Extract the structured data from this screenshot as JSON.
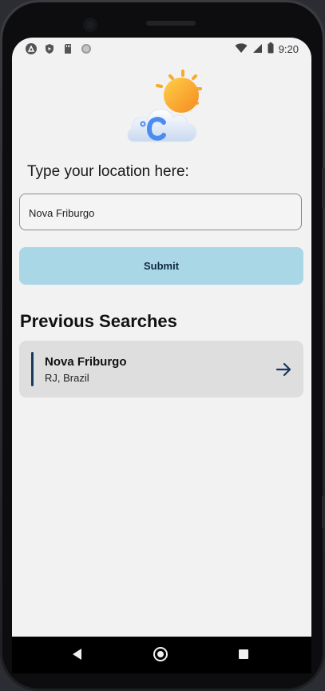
{
  "status_bar": {
    "time": "9:20",
    "left_icons": [
      "android-notification-icon",
      "shield-icon",
      "sd-card-icon",
      "dot-icon"
    ],
    "right_icons": [
      "wifi-icon",
      "signal-icon",
      "battery-icon"
    ]
  },
  "app": {
    "logo_icon": "weather-celsius-icon",
    "prompt": "Type your location here:",
    "location_input": {
      "value": "Nova Friburgo"
    },
    "submit_label": "Submit",
    "previous_searches_title": "Previous Searches",
    "previous_searches": [
      {
        "city": "Nova Friburgo",
        "region": "RJ, Brazil",
        "icon": "arrow-right-icon"
      }
    ]
  },
  "colors": {
    "background": "#f2f2f2",
    "submit_bg": "#aad7e6",
    "submit_text": "#0f2a44",
    "card_bg": "#dedede",
    "accent": "#173a5e"
  },
  "nav_bar": {
    "icons": [
      "back-icon",
      "home-icon",
      "recents-icon"
    ]
  }
}
